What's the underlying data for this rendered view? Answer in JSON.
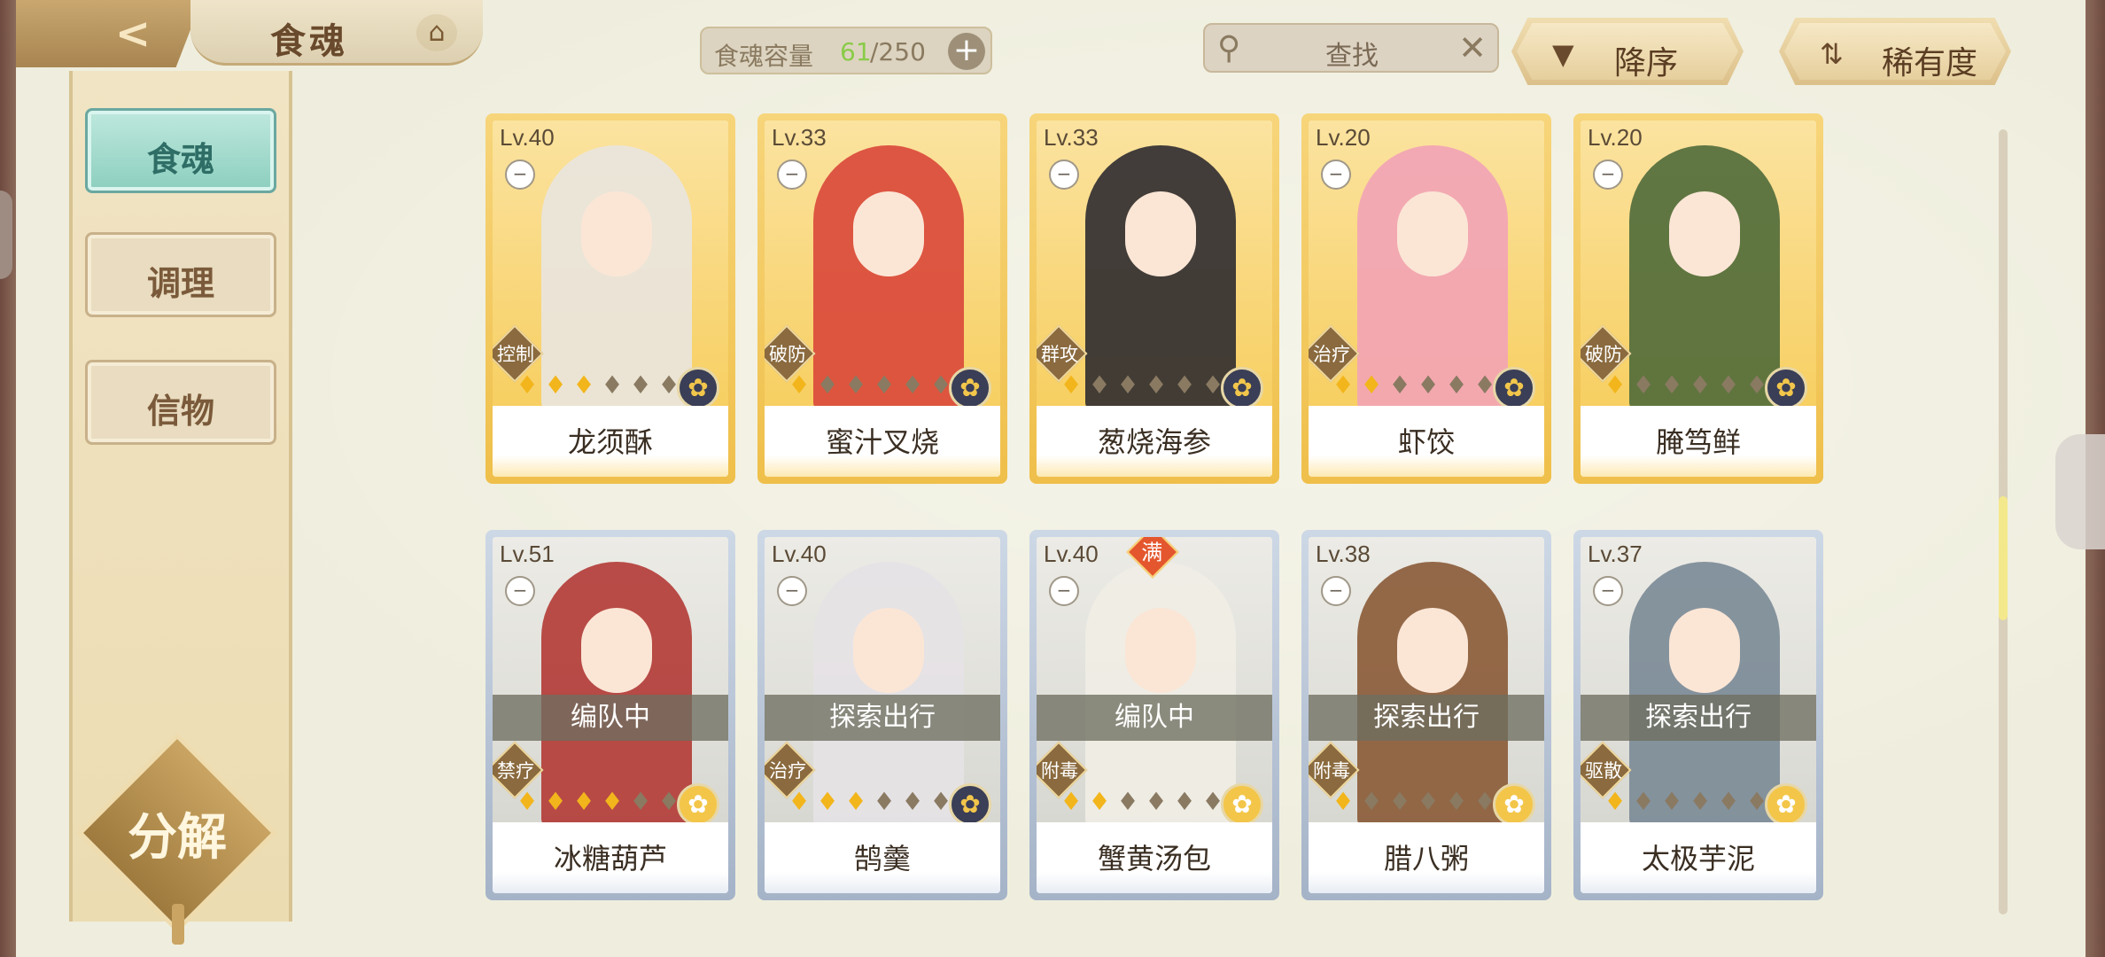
{
  "header": {
    "title": "食魂",
    "back_icon": "back-arrow-icon",
    "title_icon": "pavilion-icon",
    "capacity": {
      "label": "食魂容量",
      "current": "61",
      "max": "/250",
      "add": "+"
    },
    "search": {
      "placeholder": "查找",
      "icon": "search-icon",
      "clear": "✕"
    },
    "sort_desc": {
      "label": "降序",
      "icon": "triangle-down-icon",
      "glyph": "▼"
    },
    "sort_rarity": {
      "label": "稀有度",
      "icon": "swap-icon",
      "glyph": "⇅"
    }
  },
  "sidebar": {
    "items": [
      {
        "label": "食魂",
        "active": true
      },
      {
        "label": "调理",
        "active": false
      },
      {
        "label": "信物",
        "active": false
      }
    ],
    "decompose_label": "分解"
  },
  "cards": [
    {
      "level": "Lv.40",
      "role": "控制",
      "stars": 3,
      "name": "龙须酥",
      "frame": "gold",
      "element": "dark",
      "status": "",
      "full": ""
    },
    {
      "level": "Lv.33",
      "role": "破防",
      "stars": 1,
      "name": "蜜汁叉烧",
      "frame": "gold",
      "element": "dark",
      "status": "",
      "full": ""
    },
    {
      "level": "Lv.33",
      "role": "群攻",
      "stars": 1,
      "name": "葱烧海参",
      "frame": "gold",
      "element": "dark",
      "status": "",
      "full": ""
    },
    {
      "level": "Lv.20",
      "role": "治疗",
      "stars": 2,
      "name": "虾饺",
      "frame": "gold",
      "element": "dark",
      "status": "",
      "full": ""
    },
    {
      "level": "Lv.20",
      "role": "破防",
      "stars": 1,
      "name": "腌笃鲜",
      "frame": "gold",
      "element": "dark",
      "status": "",
      "full": ""
    },
    {
      "level": "Lv.51",
      "role": "禁疗",
      "stars": 4,
      "name": "冰糖葫芦",
      "frame": "silver",
      "element": "gold",
      "status": "编队中",
      "full": ""
    },
    {
      "level": "Lv.40",
      "role": "治疗",
      "stars": 3,
      "name": "鹄羹",
      "frame": "silver",
      "element": "dark",
      "status": "探索出行",
      "full": ""
    },
    {
      "level": "Lv.40",
      "role": "附毒",
      "stars": 2,
      "name": "蟹黄汤包",
      "frame": "silver",
      "element": "gold",
      "status": "编队中",
      "full": "满"
    },
    {
      "level": "Lv.38",
      "role": "附毒",
      "stars": 1,
      "name": "腊八粥",
      "frame": "silver",
      "element": "gold",
      "status": "探索出行",
      "full": ""
    },
    {
      "level": "Lv.37",
      "role": "驱散",
      "stars": 1,
      "name": "太极芋泥",
      "frame": "silver",
      "element": "gold",
      "status": "探索出行",
      "full": ""
    }
  ],
  "colors": {
    "accent_green": "#8acb48",
    "gold_frame": "#f2c04a",
    "silver_frame": "#b3c0d2",
    "teal_active": "#8ccfbf"
  }
}
